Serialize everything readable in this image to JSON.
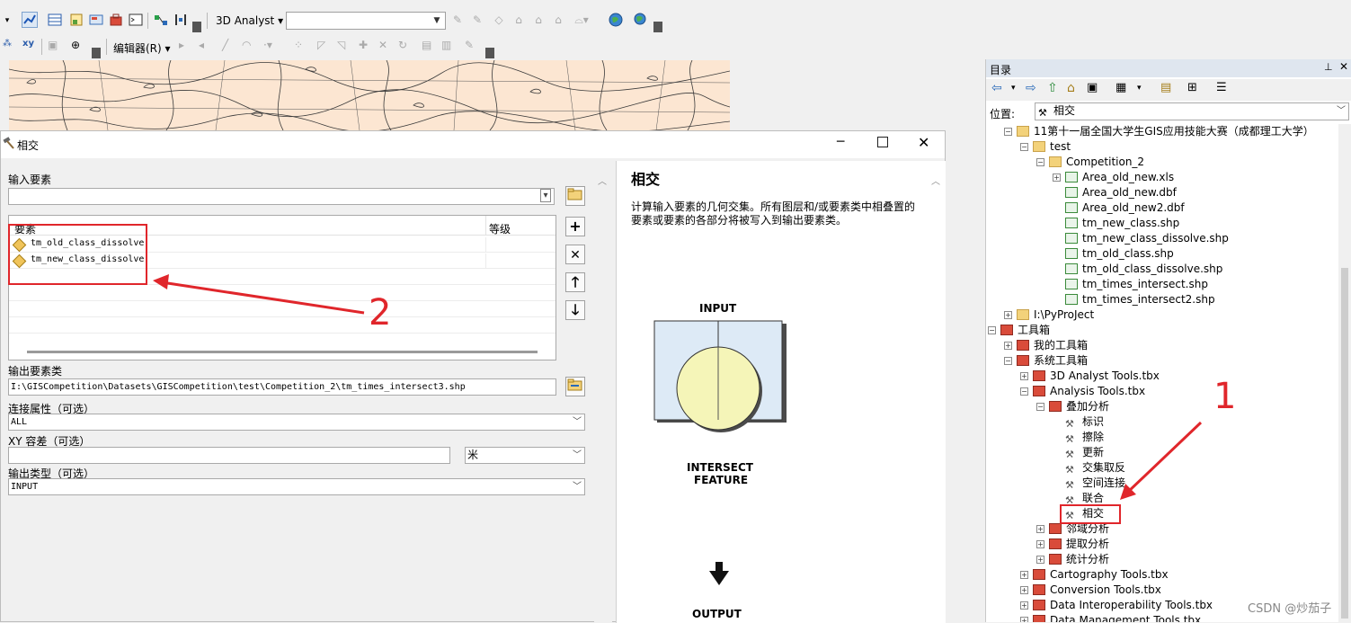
{
  "toolbar": {
    "analyst_label": "3D Analyst",
    "editor_label": "编辑器(R)",
    "layer_combo_value": ""
  },
  "dialog": {
    "title": "相交",
    "input_label": "输入要素",
    "input_value": "",
    "table_header_features": "要素",
    "table_header_rank": "等级",
    "rows": [
      {
        "name": "tm_old_class_dissolve",
        "rank": ""
      },
      {
        "name": "tm_new_class_dissolve",
        "rank": ""
      }
    ],
    "output_label": "输出要素类",
    "output_value": "I:\\GISCompetition\\Datasets\\GISCompetition\\test\\Competition_2\\tm_times_intersect3.shp",
    "join_label": "连接属性（可选）",
    "join_value": "ALL",
    "xy_label": "XY 容差（可选）",
    "xy_value": "",
    "xy_unit": "米",
    "type_label": "输出类型（可选）",
    "type_value": "INPUT",
    "help_title": "相交",
    "help_text": "计算输入要素的几何交集。所有图层和/或要素类中相叠置的要素或要素的各部分将被写入到输出要素类。",
    "diagram_input": "INPUT",
    "diagram_intersect_1": "INTERSECT",
    "diagram_intersect_2": "FEATURE",
    "diagram_output": "OUTPUT"
  },
  "catalog": {
    "title": "目录",
    "location_label": "位置:",
    "location_value": "相交",
    "items": [
      {
        "label": "11第十一届全国大学生GIS应用技能大赛（成都理工大学）",
        "icon": "folder-icon"
      },
      {
        "label": "test",
        "icon": "folder-icon"
      },
      {
        "label": "Competition_2",
        "icon": "folder-icon"
      },
      {
        "label": "Area_old_new.xls",
        "icon": "excel-icon"
      },
      {
        "label": "Area_old_new.dbf",
        "icon": "table-icon"
      },
      {
        "label": "Area_old_new2.dbf",
        "icon": "table-icon"
      },
      {
        "label": "tm_new_class.shp",
        "icon": "shapefile-icon"
      },
      {
        "label": "tm_new_class_dissolve.shp",
        "icon": "shapefile-icon"
      },
      {
        "label": "tm_old_class.shp",
        "icon": "shapefile-icon"
      },
      {
        "label": "tm_old_class_dissolve.shp",
        "icon": "shapefile-icon"
      },
      {
        "label": "tm_times_intersect.shp",
        "icon": "shapefile-icon"
      },
      {
        "label": "tm_times_intersect2.shp",
        "icon": "shapefile-icon"
      },
      {
        "label": "I:\\PyProJect",
        "icon": "folder-icon"
      },
      {
        "label": "工具箱",
        "icon": "toolbox-icon"
      },
      {
        "label": "我的工具箱",
        "icon": "toolbox-icon"
      },
      {
        "label": "系统工具箱",
        "icon": "toolbox-icon"
      },
      {
        "label": "3D Analyst Tools.tbx",
        "icon": "toolbox-icon"
      },
      {
        "label": "Analysis Tools.tbx",
        "icon": "toolbox-icon"
      },
      {
        "label": "叠加分析",
        "icon": "toolset-icon"
      },
      {
        "label": "标识",
        "icon": "hammer-icon"
      },
      {
        "label": "擦除",
        "icon": "hammer-icon"
      },
      {
        "label": "更新",
        "icon": "hammer-icon"
      },
      {
        "label": "交集取反",
        "icon": "hammer-icon"
      },
      {
        "label": "空间连接",
        "icon": "hammer-icon"
      },
      {
        "label": "联合",
        "icon": "hammer-icon"
      },
      {
        "label": "相交",
        "icon": "hammer-icon"
      },
      {
        "label": "邻域分析",
        "icon": "toolset-icon"
      },
      {
        "label": "提取分析",
        "icon": "toolset-icon"
      },
      {
        "label": "统计分析",
        "icon": "toolset-icon"
      },
      {
        "label": "Cartography Tools.tbx",
        "icon": "toolbox-icon"
      },
      {
        "label": "Conversion Tools.tbx",
        "icon": "toolbox-icon"
      },
      {
        "label": "Data Interoperability Tools.tbx",
        "icon": "toolbox-icon"
      },
      {
        "label": "Data Management Tools.tbx",
        "icon": "toolbox-icon"
      }
    ]
  },
  "annotations": {
    "label_1": "1",
    "label_2": "2"
  },
  "watermark": "CSDN @炒茄子",
  "colors": {
    "annotation_red": "#e0262b",
    "catalog_header": "#dfe6ef",
    "map_fill": "#fce6d2"
  }
}
